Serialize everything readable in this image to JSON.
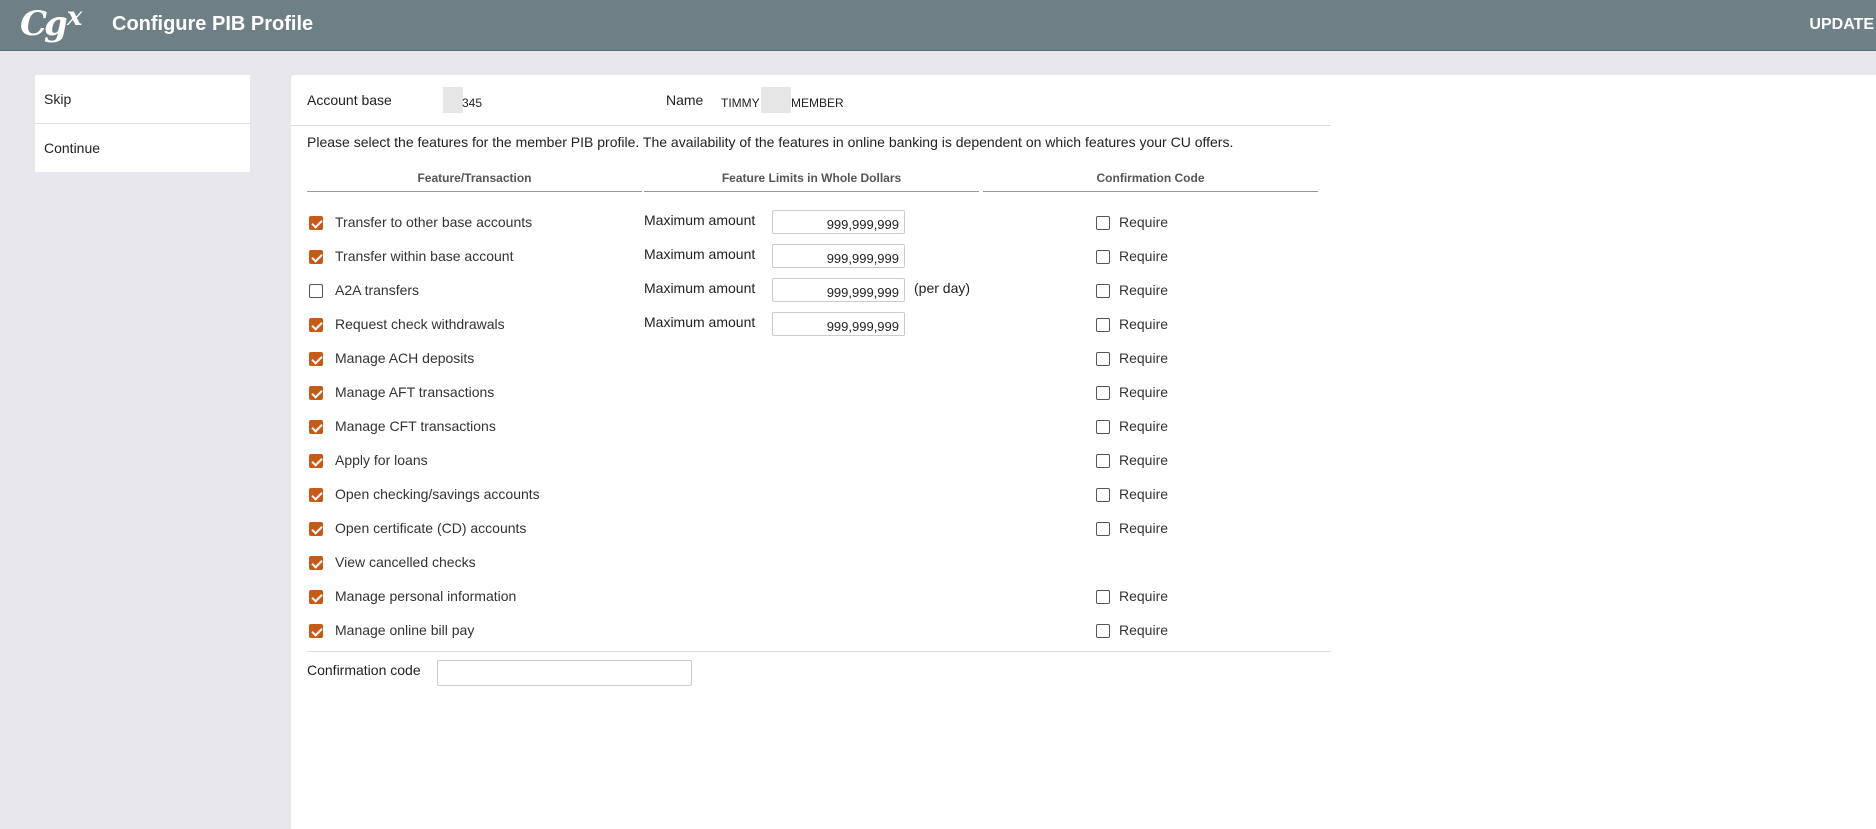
{
  "header": {
    "logo_text": "CGX",
    "title": "Configure PIB Profile",
    "update_label": "UPDATE"
  },
  "sidebar": {
    "items": [
      {
        "label": "Skip"
      },
      {
        "label": "Continue"
      }
    ]
  },
  "account": {
    "base_label": "Account base",
    "base_value": "345",
    "name_label": "Name",
    "name_first": "TIMMY",
    "name_last": "MEMBER"
  },
  "intro_text": "Please select the features for the member PIB profile. The availability of the features in online banking is dependent on which features your CU offers.",
  "columns": {
    "feature": "Feature/Transaction",
    "limits": "Feature Limits in Whole Dollars",
    "confirmation": "Confirmation Code"
  },
  "max_label": "Maximum amount",
  "require_label": "Require",
  "per_day_label": "(per day)",
  "features": [
    {
      "label": "Transfer to other base accounts",
      "checked": true,
      "amount": "999,999,999",
      "per_day": false,
      "require": false,
      "has_require": true
    },
    {
      "label": "Transfer within base account",
      "checked": true,
      "amount": "999,999,999",
      "per_day": false,
      "require": false,
      "has_require": true
    },
    {
      "label": "A2A transfers",
      "checked": false,
      "amount": "999,999,999",
      "per_day": true,
      "require": false,
      "has_require": true
    },
    {
      "label": "Request check withdrawals",
      "checked": true,
      "amount": "999,999,999",
      "per_day": false,
      "require": false,
      "has_require": true
    },
    {
      "label": "Manage ACH deposits",
      "checked": true,
      "amount": null,
      "per_day": false,
      "require": false,
      "has_require": true
    },
    {
      "label": "Manage AFT transactions",
      "checked": true,
      "amount": null,
      "per_day": false,
      "require": false,
      "has_require": true
    },
    {
      "label": "Manage CFT transactions",
      "checked": true,
      "amount": null,
      "per_day": false,
      "require": false,
      "has_require": true
    },
    {
      "label": "Apply for loans",
      "checked": true,
      "amount": null,
      "per_day": false,
      "require": false,
      "has_require": true
    },
    {
      "label": "Open checking/savings accounts",
      "checked": true,
      "amount": null,
      "per_day": false,
      "require": false,
      "has_require": true
    },
    {
      "label": "Open certificate (CD) accounts",
      "checked": true,
      "amount": null,
      "per_day": false,
      "require": false,
      "has_require": true
    },
    {
      "label": "View cancelled checks",
      "checked": true,
      "amount": null,
      "per_day": false,
      "require": false,
      "has_require": false
    },
    {
      "label": "Manage personal information",
      "checked": true,
      "amount": null,
      "per_day": false,
      "require": false,
      "has_require": true
    },
    {
      "label": "Manage online bill pay",
      "checked": true,
      "amount": null,
      "per_day": false,
      "require": false,
      "has_require": true
    }
  ],
  "confirmation": {
    "label": "Confirmation code",
    "value": ""
  },
  "colors": {
    "topbar": "#6e7f86",
    "checkbox_accent": "#c85a18",
    "background": "#e8e8ec"
  }
}
